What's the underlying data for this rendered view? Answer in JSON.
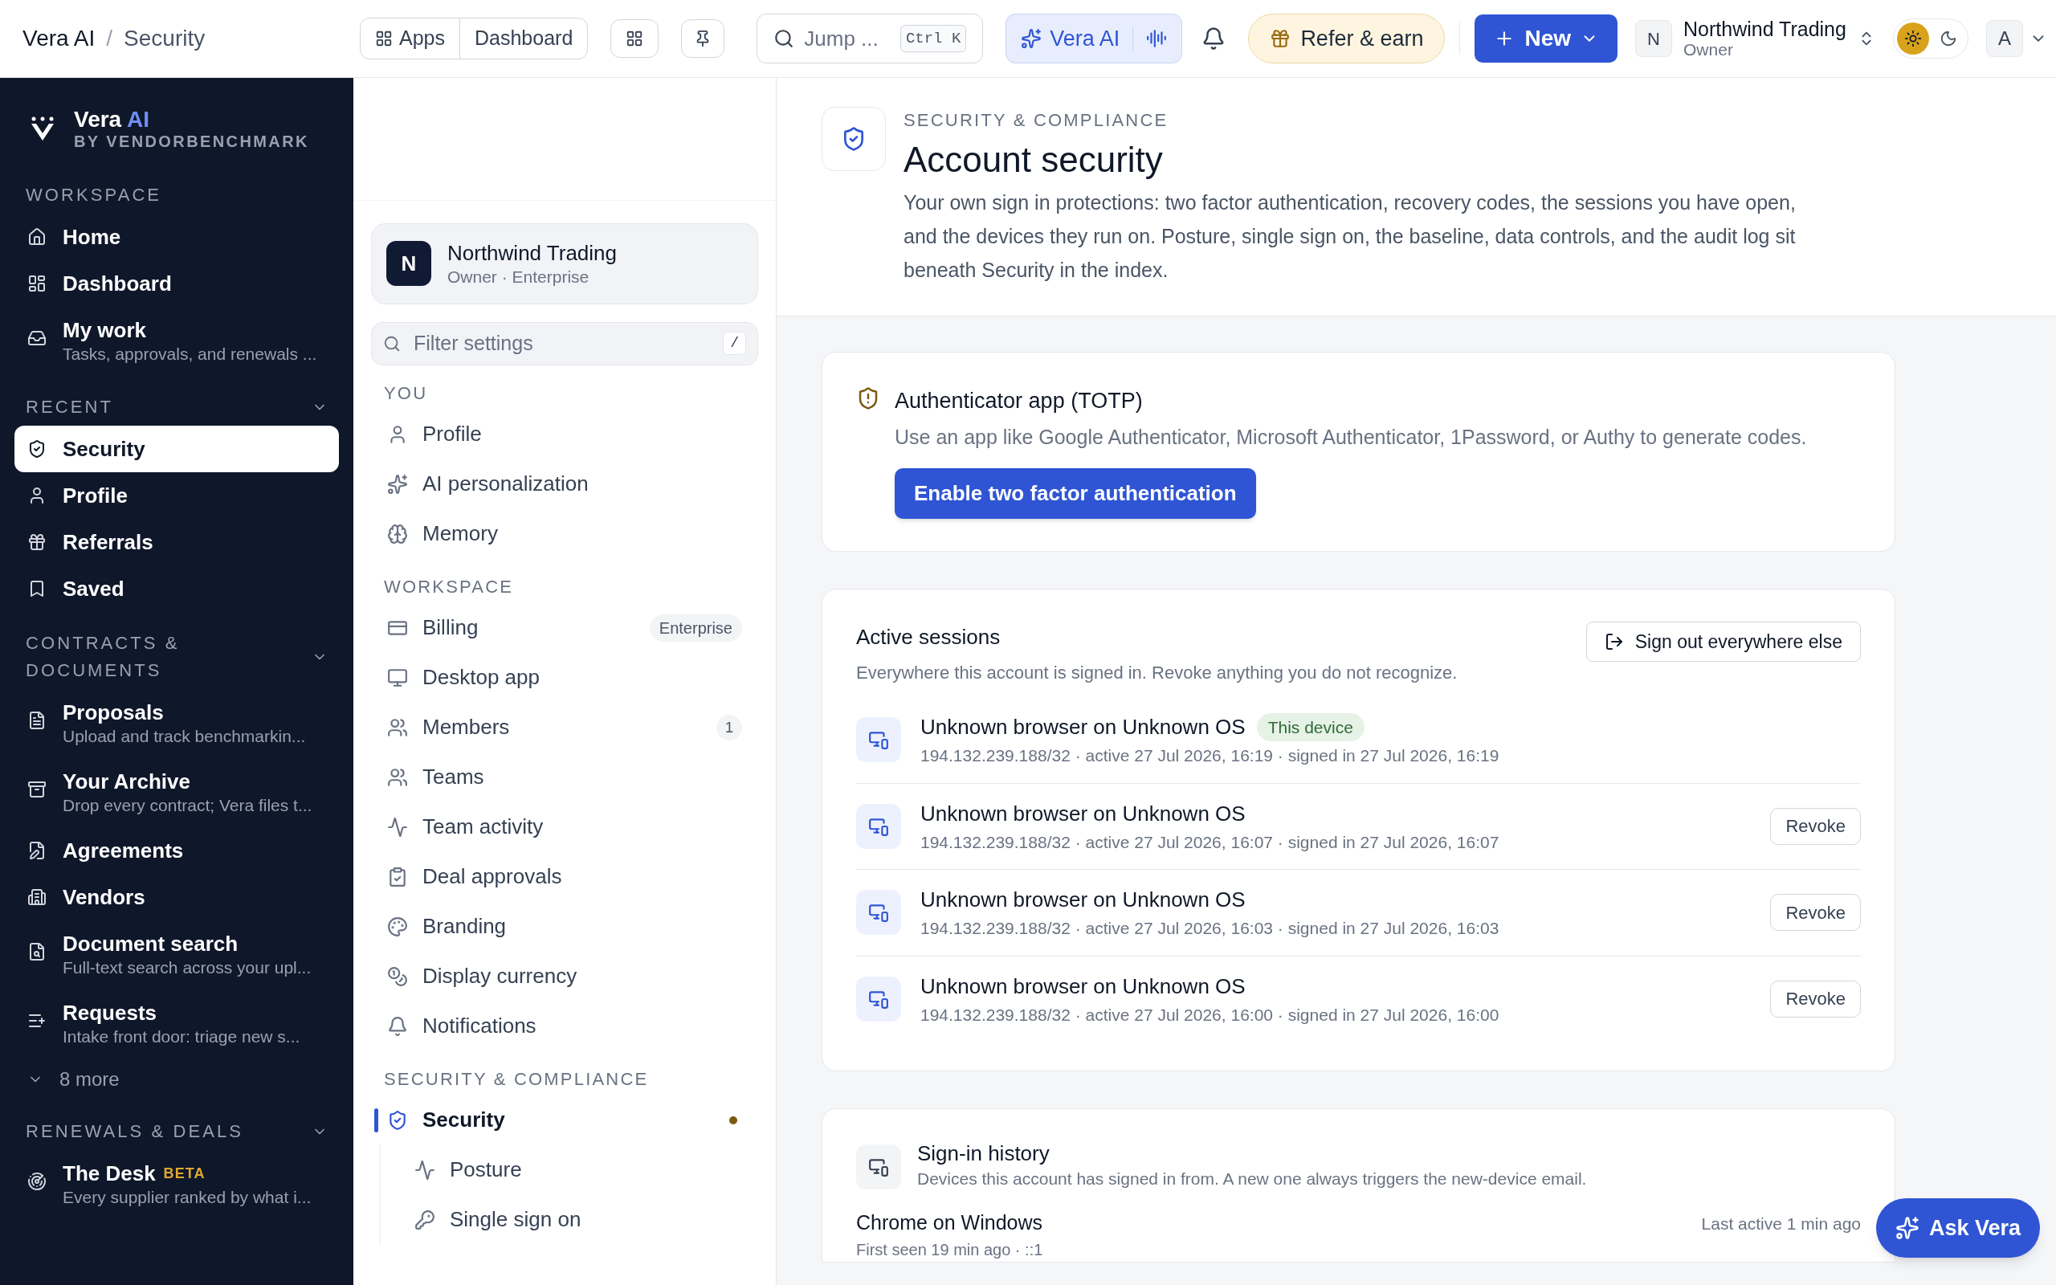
{
  "topbar": {
    "breadcrumb": [
      "Vera AI",
      "Security"
    ],
    "breadcrumb_separator": "/",
    "apps_button": "Apps",
    "dashboard_button": "Dashboard",
    "search": {
      "placeholder": "Jump ...",
      "shortcut": "Ctrl K"
    },
    "assistant_button": "Vera AI",
    "refer_button": "Refer & earn",
    "new_button": "New",
    "org": {
      "name": "Northwind Trading",
      "role": "Owner",
      "initial": "N"
    },
    "theme": [
      {
        "kind": "light",
        "selected": true
      },
      {
        "kind": "dark",
        "selected": false
      }
    ],
    "avatar": "A"
  },
  "sidebar": {
    "brand": {
      "name": "Vera",
      "accent": "AI",
      "byline": "BY VENDORBENCHMARK"
    },
    "sections": [
      {
        "title": "WORKSPACE",
        "collapsible": false,
        "items": [
          {
            "kind": "item",
            "label": "Home",
            "selected": false
          },
          {
            "kind": "item",
            "label": "Dashboard",
            "selected": false
          },
          {
            "kind": "item",
            "label": "My work",
            "subtitle": "Tasks, approvals, and renewals ...",
            "selected": false
          }
        ]
      },
      {
        "title": "RECENT",
        "collapsible": true,
        "items": [
          {
            "kind": "item",
            "label": "Security",
            "selected": true
          },
          {
            "kind": "item",
            "label": "Profile",
            "selected": false
          },
          {
            "kind": "item",
            "label": "Referrals",
            "selected": false
          },
          {
            "kind": "item",
            "label": "Saved",
            "selected": false
          }
        ]
      },
      {
        "title": "CONTRACTS & DOCUMENTS",
        "collapsible": true,
        "items": [
          {
            "kind": "item",
            "label": "Proposals",
            "subtitle": "Upload and track benchmarkin...",
            "selected": false
          },
          {
            "kind": "item",
            "label": "Your Archive",
            "subtitle": "Drop every contract; Vera files t...",
            "selected": false
          },
          {
            "kind": "item",
            "label": "Agreements",
            "selected": false
          },
          {
            "kind": "item",
            "label": "Vendors",
            "selected": false
          },
          {
            "kind": "item",
            "label": "Document search",
            "subtitle": "Full-text search across your upl...",
            "selected": false
          },
          {
            "kind": "item",
            "label": "Requests",
            "subtitle": "Intake front door: triage new s...",
            "selected": false
          },
          {
            "kind": "more",
            "label": "8 more",
            "selected": false
          }
        ]
      },
      {
        "title": "RENEWALS & DEALS",
        "collapsible": true,
        "items": [
          {
            "kind": "item",
            "label": "The Desk",
            "badge": "BETA",
            "subtitle": "Every supplier ranked by what i...",
            "selected": false
          }
        ]
      }
    ]
  },
  "settings_nav": {
    "org": {
      "initial": "N",
      "name": "Northwind Trading",
      "detail": "Owner · Enterprise"
    },
    "filter": {
      "placeholder": "Filter settings",
      "shortcut": "/"
    },
    "groups": [
      {
        "title": "YOU",
        "items": [
          {
            "label": "Profile",
            "selected": false
          },
          {
            "label": "AI personalization",
            "selected": false
          },
          {
            "label": "Memory",
            "selected": false
          }
        ]
      },
      {
        "title": "WORKSPACE",
        "items": [
          {
            "label": "Billing",
            "badge": "Enterprise",
            "selected": false
          },
          {
            "label": "Desktop app",
            "selected": false
          },
          {
            "label": "Members",
            "count": "1",
            "selected": false
          },
          {
            "label": "Teams",
            "selected": false
          },
          {
            "label": "Team activity",
            "selected": false
          },
          {
            "label": "Deal approvals",
            "selected": false
          },
          {
            "label": "Branding",
            "selected": false
          },
          {
            "label": "Display currency",
            "selected": false
          },
          {
            "label": "Notifications",
            "selected": false
          }
        ]
      },
      {
        "title": "SECURITY & COMPLIANCE",
        "items": [
          {
            "label": "Security",
            "selected": true,
            "color": "#7a5a12",
            "children": [
              {
                "label": "Posture",
                "selected": false
              },
              {
                "label": "Single sign on",
                "selected": false
              }
            ]
          }
        ]
      }
    ]
  },
  "page": {
    "kicker": "SECURITY & COMPLIANCE",
    "title": "Account security",
    "description": "Your own sign in protections: two factor authentication, recovery codes, the sessions you have open, and the devices they run on. Posture, single sign on, the baseline, data controls, and the audit log sit beneath Security in the index.",
    "totp": {
      "title": "Authenticator app (TOTP)",
      "description": "Use an app like Google Authenticator, Microsoft Authenticator, 1Password, or Authy to generate codes.",
      "button": "Enable two factor authentication"
    },
    "sessions": {
      "title": "Active sessions",
      "description": "Everywhere this account is signed in. Revoke anything you do not recognize.",
      "button": "Sign out everywhere else",
      "rows": [
        {
          "title": "Unknown browser on Unknown OS",
          "badge": "This device",
          "meta": "194.132.239.188/32 · active 27 Jul 2026, 16:19 · signed in 27 Jul 2026, 16:19"
        },
        {
          "title": "Unknown browser on Unknown OS",
          "action": "Revoke",
          "meta": "194.132.239.188/32 · active 27 Jul 2026, 16:07 · signed in 27 Jul 2026, 16:07"
        },
        {
          "title": "Unknown browser on Unknown OS",
          "action": "Revoke",
          "meta": "194.132.239.188/32 · active 27 Jul 2026, 16:03 · signed in 27 Jul 2026, 16:03"
        },
        {
          "title": "Unknown browser on Unknown OS",
          "action": "Revoke",
          "meta": "194.132.239.188/32 · active 27 Jul 2026, 16:00 · signed in 27 Jul 2026, 16:00"
        }
      ]
    },
    "history": {
      "title": "Sign-in history",
      "description": "Devices this account has signed in from. A new one always triggers the new-device email.",
      "rows": [
        {
          "title": "Chrome on Windows",
          "last_active": "Last active 1 min ago",
          "meta": "First seen 19 min ago · ::1"
        }
      ]
    }
  },
  "ask_button": "Ask Vera"
}
